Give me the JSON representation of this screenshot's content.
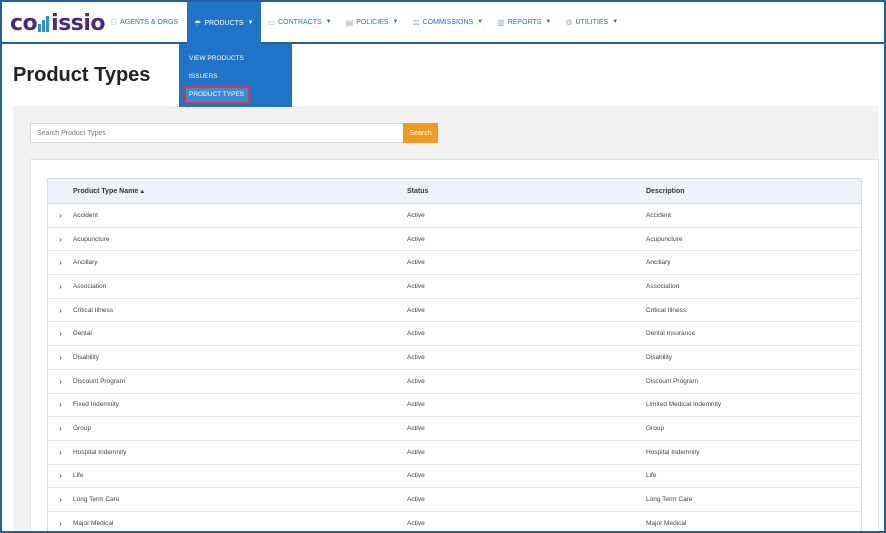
{
  "logo": {
    "text_left": "co",
    "text_right": "issio"
  },
  "nav": {
    "items": [
      {
        "label": "AGENTS & ORGS",
        "icon": "people-icon",
        "caret": false,
        "active": false
      },
      {
        "label": "PRODUCTS",
        "icon": "products-icon",
        "caret": true,
        "active": true
      },
      {
        "label": "CONTRACTS",
        "icon": "contracts-icon",
        "caret": true,
        "active": false
      },
      {
        "label": "POLICIES",
        "icon": "policies-icon",
        "caret": true,
        "active": false
      },
      {
        "label": "COMMISSIONS",
        "icon": "commissions-icon",
        "caret": true,
        "active": false
      },
      {
        "label": "REPORTS",
        "icon": "reports-icon",
        "caret": true,
        "active": false
      },
      {
        "label": "UTILITIES",
        "icon": "utilities-icon",
        "caret": true,
        "active": false
      }
    ]
  },
  "dropdown": {
    "items": [
      {
        "label": "VIEW PRODUCTS"
      },
      {
        "label": "ISSUERS"
      },
      {
        "label": "PRODUCT TYPES"
      }
    ]
  },
  "page": {
    "title": "Product Types"
  },
  "search": {
    "placeholder": "Search Product Types",
    "button": "Search"
  },
  "table": {
    "columns": {
      "name": "Product Type Name",
      "status": "Status",
      "description": "Description"
    },
    "rows": [
      {
        "name": "Accident",
        "status": "Active",
        "description": "Accident"
      },
      {
        "name": "Acupuncture",
        "status": "Active",
        "description": "Acupuncture"
      },
      {
        "name": "Ancillary",
        "status": "Active",
        "description": "Ancillary"
      },
      {
        "name": "Association",
        "status": "Active",
        "description": "Association"
      },
      {
        "name": "Critical Illness",
        "status": "Active",
        "description": "Critical Illness"
      },
      {
        "name": "Dental",
        "status": "Active",
        "description": "Dental Insurance"
      },
      {
        "name": "Disability",
        "status": "Active",
        "description": "Disability"
      },
      {
        "name": "Discount Program",
        "status": "Active",
        "description": "Discount Program"
      },
      {
        "name": "Fixed Indemnity",
        "status": "Active",
        "description": "Limited Medical Indemnity"
      },
      {
        "name": "Group",
        "status": "Active",
        "description": "Group"
      },
      {
        "name": "Hospital Indemnity",
        "status": "Active",
        "description": "Hospital Indemnity"
      },
      {
        "name": "Life",
        "status": "Active",
        "description": "Life"
      },
      {
        "name": "Long Term Care",
        "status": "Active",
        "description": "Long Term Care"
      },
      {
        "name": "Major Medical",
        "status": "Active",
        "description": "Major Medical"
      }
    ]
  },
  "colors": {
    "brand": "#4b2a86",
    "accent": "#1f73c9",
    "search_button": "#f39a1e",
    "highlight": "#d9363e"
  }
}
